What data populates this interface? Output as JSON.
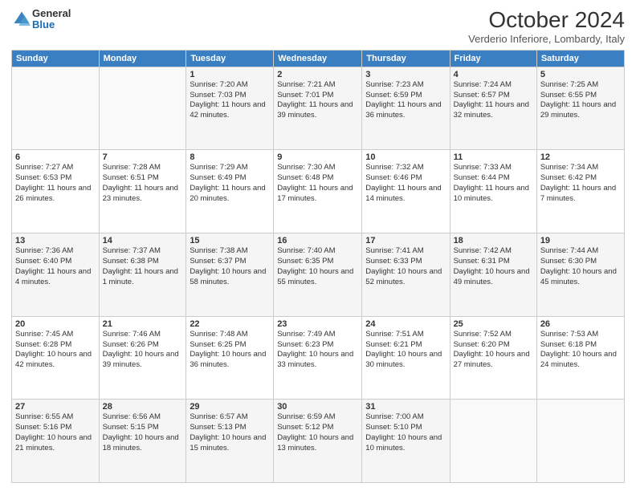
{
  "logo": {
    "general": "General",
    "blue": "Blue"
  },
  "header": {
    "title": "October 2024",
    "subtitle": "Verderio Inferiore, Lombardy, Italy"
  },
  "weekdays": [
    "Sunday",
    "Monday",
    "Tuesday",
    "Wednesday",
    "Thursday",
    "Friday",
    "Saturday"
  ],
  "weeks": [
    [
      {
        "day": "",
        "info": ""
      },
      {
        "day": "",
        "info": ""
      },
      {
        "day": "1",
        "info": "Sunrise: 7:20 AM\nSunset: 7:03 PM\nDaylight: 11 hours and 42 minutes."
      },
      {
        "day": "2",
        "info": "Sunrise: 7:21 AM\nSunset: 7:01 PM\nDaylight: 11 hours and 39 minutes."
      },
      {
        "day": "3",
        "info": "Sunrise: 7:23 AM\nSunset: 6:59 PM\nDaylight: 11 hours and 36 minutes."
      },
      {
        "day": "4",
        "info": "Sunrise: 7:24 AM\nSunset: 6:57 PM\nDaylight: 11 hours and 32 minutes."
      },
      {
        "day": "5",
        "info": "Sunrise: 7:25 AM\nSunset: 6:55 PM\nDaylight: 11 hours and 29 minutes."
      }
    ],
    [
      {
        "day": "6",
        "info": "Sunrise: 7:27 AM\nSunset: 6:53 PM\nDaylight: 11 hours and 26 minutes."
      },
      {
        "day": "7",
        "info": "Sunrise: 7:28 AM\nSunset: 6:51 PM\nDaylight: 11 hours and 23 minutes."
      },
      {
        "day": "8",
        "info": "Sunrise: 7:29 AM\nSunset: 6:49 PM\nDaylight: 11 hours and 20 minutes."
      },
      {
        "day": "9",
        "info": "Sunrise: 7:30 AM\nSunset: 6:48 PM\nDaylight: 11 hours and 17 minutes."
      },
      {
        "day": "10",
        "info": "Sunrise: 7:32 AM\nSunset: 6:46 PM\nDaylight: 11 hours and 14 minutes."
      },
      {
        "day": "11",
        "info": "Sunrise: 7:33 AM\nSunset: 6:44 PM\nDaylight: 11 hours and 10 minutes."
      },
      {
        "day": "12",
        "info": "Sunrise: 7:34 AM\nSunset: 6:42 PM\nDaylight: 11 hours and 7 minutes."
      }
    ],
    [
      {
        "day": "13",
        "info": "Sunrise: 7:36 AM\nSunset: 6:40 PM\nDaylight: 11 hours and 4 minutes."
      },
      {
        "day": "14",
        "info": "Sunrise: 7:37 AM\nSunset: 6:38 PM\nDaylight: 11 hours and 1 minute."
      },
      {
        "day": "15",
        "info": "Sunrise: 7:38 AM\nSunset: 6:37 PM\nDaylight: 10 hours and 58 minutes."
      },
      {
        "day": "16",
        "info": "Sunrise: 7:40 AM\nSunset: 6:35 PM\nDaylight: 10 hours and 55 minutes."
      },
      {
        "day": "17",
        "info": "Sunrise: 7:41 AM\nSunset: 6:33 PM\nDaylight: 10 hours and 52 minutes."
      },
      {
        "day": "18",
        "info": "Sunrise: 7:42 AM\nSunset: 6:31 PM\nDaylight: 10 hours and 49 minutes."
      },
      {
        "day": "19",
        "info": "Sunrise: 7:44 AM\nSunset: 6:30 PM\nDaylight: 10 hours and 45 minutes."
      }
    ],
    [
      {
        "day": "20",
        "info": "Sunrise: 7:45 AM\nSunset: 6:28 PM\nDaylight: 10 hours and 42 minutes."
      },
      {
        "day": "21",
        "info": "Sunrise: 7:46 AM\nSunset: 6:26 PM\nDaylight: 10 hours and 39 minutes."
      },
      {
        "day": "22",
        "info": "Sunrise: 7:48 AM\nSunset: 6:25 PM\nDaylight: 10 hours and 36 minutes."
      },
      {
        "day": "23",
        "info": "Sunrise: 7:49 AM\nSunset: 6:23 PM\nDaylight: 10 hours and 33 minutes."
      },
      {
        "day": "24",
        "info": "Sunrise: 7:51 AM\nSunset: 6:21 PM\nDaylight: 10 hours and 30 minutes."
      },
      {
        "day": "25",
        "info": "Sunrise: 7:52 AM\nSunset: 6:20 PM\nDaylight: 10 hours and 27 minutes."
      },
      {
        "day": "26",
        "info": "Sunrise: 7:53 AM\nSunset: 6:18 PM\nDaylight: 10 hours and 24 minutes."
      }
    ],
    [
      {
        "day": "27",
        "info": "Sunrise: 6:55 AM\nSunset: 5:16 PM\nDaylight: 10 hours and 21 minutes."
      },
      {
        "day": "28",
        "info": "Sunrise: 6:56 AM\nSunset: 5:15 PM\nDaylight: 10 hours and 18 minutes."
      },
      {
        "day": "29",
        "info": "Sunrise: 6:57 AM\nSunset: 5:13 PM\nDaylight: 10 hours and 15 minutes."
      },
      {
        "day": "30",
        "info": "Sunrise: 6:59 AM\nSunset: 5:12 PM\nDaylight: 10 hours and 13 minutes."
      },
      {
        "day": "31",
        "info": "Sunrise: 7:00 AM\nSunset: 5:10 PM\nDaylight: 10 hours and 10 minutes."
      },
      {
        "day": "",
        "info": ""
      },
      {
        "day": "",
        "info": ""
      }
    ]
  ]
}
